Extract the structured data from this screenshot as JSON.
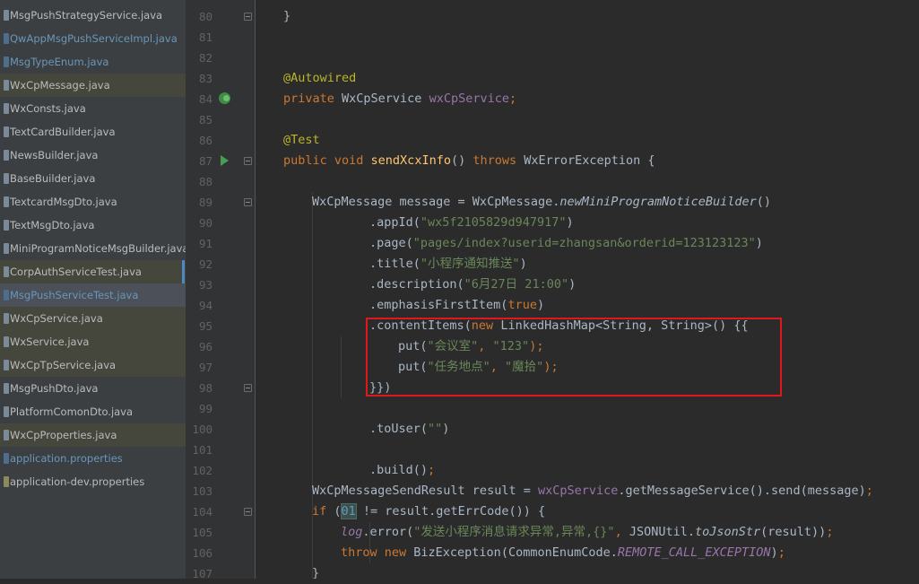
{
  "sidebar": {
    "files": [
      {
        "label": "MsgPushStrategyService.java",
        "style": "normal"
      },
      {
        "label": "QwAppMsgPushServiceImpl.java",
        "style": "blue"
      },
      {
        "label": "MsgTypeEnum.java",
        "style": "blue"
      },
      {
        "label": "WxCpMessage.java",
        "style": "normal",
        "highlight": true
      },
      {
        "label": "WxConsts.java",
        "style": "normal"
      },
      {
        "label": "TextCardBuilder.java",
        "style": "normal"
      },
      {
        "label": "NewsBuilder.java",
        "style": "normal"
      },
      {
        "label": "BaseBuilder.java",
        "style": "normal"
      },
      {
        "label": "TextcardMsgDto.java",
        "style": "normal"
      },
      {
        "label": "TextMsgDto.java",
        "style": "normal"
      },
      {
        "label": "MiniProgramNoticeMsgBuilder.java",
        "style": "normal"
      },
      {
        "label": "CorpAuthServiceTest.java",
        "style": "normal",
        "highlight": true
      },
      {
        "label": "MsgPushServiceTest.java",
        "style": "blue",
        "selected": true
      },
      {
        "label": "WxCpService.java",
        "style": "normal",
        "highlight": true
      },
      {
        "label": "WxService.java",
        "style": "normal",
        "highlight": true
      },
      {
        "label": "WxCpTpService.java",
        "style": "normal",
        "highlight": true
      },
      {
        "label": "MsgPushDto.java",
        "style": "normal"
      },
      {
        "label": "PlatformComonDto.java",
        "style": "normal"
      },
      {
        "label": "WxCpProperties.java",
        "style": "normal",
        "highlight": true
      },
      {
        "label": "application.properties",
        "style": "blue-prop"
      },
      {
        "label": "application-dev.properties",
        "style": "prop"
      }
    ]
  },
  "editor": {
    "lines": [
      {
        "n": "80",
        "indent": 1,
        "tokens": [
          {
            "t": "}"
          }
        ]
      },
      {
        "n": "81",
        "indent": 0,
        "tokens": []
      },
      {
        "n": "82",
        "indent": 0,
        "tokens": []
      },
      {
        "n": "83",
        "indent": 1,
        "tokens": [
          {
            "t": "@Autowired",
            "c": "an"
          }
        ]
      },
      {
        "n": "84",
        "indent": 1,
        "tokens": [
          {
            "t": "private ",
            "c": "kw"
          },
          {
            "t": "WxCpService "
          },
          {
            "t": "wxCpService",
            "c": "fld"
          },
          {
            "t": ";",
            "c": "kw"
          }
        ]
      },
      {
        "n": "85",
        "indent": 0,
        "tokens": []
      },
      {
        "n": "86",
        "indent": 1,
        "tokens": [
          {
            "t": "@Test",
            "c": "an"
          }
        ]
      },
      {
        "n": "87",
        "indent": 1,
        "tokens": [
          {
            "t": "public void ",
            "c": "kw"
          },
          {
            "t": "sendXcxInfo",
            "c": "fn"
          },
          {
            "t": "() "
          },
          {
            "t": "throws ",
            "c": "kw"
          },
          {
            "t": "WxErrorException {"
          }
        ]
      },
      {
        "n": "88",
        "indent": 0,
        "tokens": []
      },
      {
        "n": "89",
        "indent": 2,
        "tokens": [
          {
            "t": "WxCpMessage message = WxCpMessage."
          },
          {
            "t": "newMiniProgramNoticeBuilder",
            "c": "it"
          },
          {
            "t": "()"
          }
        ]
      },
      {
        "n": "90",
        "indent": 4,
        "tokens": [
          {
            "t": ".appId("
          },
          {
            "t": "\"wx5f2105829d947917\"",
            "c": "str"
          },
          {
            "t": ")"
          }
        ]
      },
      {
        "n": "91",
        "indent": 4,
        "tokens": [
          {
            "t": ".page("
          },
          {
            "t": "\"pages/index?userid=zhangsan&orderid=123123123\"",
            "c": "str"
          },
          {
            "t": ")"
          }
        ]
      },
      {
        "n": "92",
        "indent": 4,
        "tokens": [
          {
            "t": ".title("
          },
          {
            "t": "\"小程序通知推送\"",
            "c": "str"
          },
          {
            "t": ")"
          }
        ]
      },
      {
        "n": "93",
        "indent": 4,
        "tokens": [
          {
            "t": ".description("
          },
          {
            "t": "\"6月27日 21:00\"",
            "c": "str"
          },
          {
            "t": ")"
          }
        ]
      },
      {
        "n": "94",
        "indent": 4,
        "tokens": [
          {
            "t": ".emphasisFirstItem("
          },
          {
            "t": "true",
            "c": "kw"
          },
          {
            "t": ")"
          }
        ]
      },
      {
        "n": "95",
        "indent": 4,
        "tokens": [
          {
            "t": ".contentItems("
          },
          {
            "t": "new ",
            "c": "kw"
          },
          {
            "t": "LinkedHashMap<String, String>() {{"
          }
        ]
      },
      {
        "n": "96",
        "indent": 5,
        "tokens": [
          {
            "t": "put("
          },
          {
            "t": "\"会议室\"",
            "c": "str"
          },
          {
            "t": ", ",
            "c": "kw"
          },
          {
            "t": "\"123\"",
            "c": "str"
          },
          {
            "t": ");",
            "c": "kw"
          }
        ]
      },
      {
        "n": "97",
        "indent": 5,
        "tokens": [
          {
            "t": "put("
          },
          {
            "t": "\"任务地点\"",
            "c": "str"
          },
          {
            "t": ", ",
            "c": "kw"
          },
          {
            "t": "\"魔拾\"",
            "c": "str"
          },
          {
            "t": ");",
            "c": "kw"
          }
        ]
      },
      {
        "n": "98",
        "indent": 4,
        "tokens": [
          {
            "t": "}})"
          }
        ]
      },
      {
        "n": "99",
        "indent": 0,
        "tokens": []
      },
      {
        "n": "100",
        "indent": 4,
        "tokens": [
          {
            "t": ".toUser("
          },
          {
            "t": "\"\"",
            "c": "str"
          },
          {
            "t": ")"
          }
        ]
      },
      {
        "n": "101",
        "indent": 0,
        "tokens": []
      },
      {
        "n": "102",
        "indent": 4,
        "tokens": [
          {
            "t": ".build()"
          },
          {
            "t": ";",
            "c": "kw"
          }
        ]
      },
      {
        "n": "103",
        "indent": 2,
        "tokens": [
          {
            "t": "WxCpMessageSendResult result = "
          },
          {
            "t": "wxCpService",
            "c": "fld"
          },
          {
            "t": ".getMessageService().send(message)"
          },
          {
            "t": ";",
            "c": "kw"
          }
        ]
      },
      {
        "n": "104",
        "indent": 2,
        "tokens": [
          {
            "t": "if ",
            "c": "kw"
          },
          {
            "t": "("
          },
          {
            "t": "01",
            "c": "num brm"
          },
          {
            "t": " != result.getErrCode()) {"
          }
        ]
      },
      {
        "n": "105",
        "indent": 3,
        "tokens": [
          {
            "t": "log",
            "c": "fldi"
          },
          {
            "t": ".error("
          },
          {
            "t": "\"发送小程序消息请求异常,异常,{}\"",
            "c": "str"
          },
          {
            "t": ", ",
            "c": "kw"
          },
          {
            "t": "JSONUtil."
          },
          {
            "t": "toJsonStr",
            "c": "it"
          },
          {
            "t": "(result))"
          },
          {
            "t": ";",
            "c": "kw"
          }
        ]
      },
      {
        "n": "106",
        "indent": 3,
        "tokens": [
          {
            "t": "throw new ",
            "c": "kw"
          },
          {
            "t": "BizException(CommonEnumCode."
          },
          {
            "t": "REMOTE_CALL_EXCEPTION",
            "c": "fldi"
          },
          {
            "t": ")"
          },
          {
            "t": ";",
            "c": "kw"
          }
        ]
      },
      {
        "n": "107",
        "indent": 2,
        "tokens": [
          {
            "t": "}"
          }
        ]
      }
    ]
  },
  "gutter_icons": [
    {
      "line": "80",
      "icon": "fold-icon"
    },
    {
      "line": "84",
      "icon": "autowired-bean-icon"
    },
    {
      "line": "87",
      "icon": "run-test-icon"
    },
    {
      "line": "87",
      "icon": "fold-icon"
    },
    {
      "line": "89",
      "icon": "fold-icon"
    },
    {
      "line": "98",
      "icon": "fold-icon"
    },
    {
      "line": "104",
      "icon": "fold-icon"
    }
  ],
  "colors": {
    "editor_bg": "#2b2b2b",
    "sidebar_bg": "#3c3f41",
    "gutter_bg": "#313335",
    "keyword": "#cc7832",
    "string": "#6a8759",
    "annotation": "#bbb529",
    "method": "#ffc66d",
    "field": "#9876aa",
    "highlight_box": "#e0181e"
  }
}
